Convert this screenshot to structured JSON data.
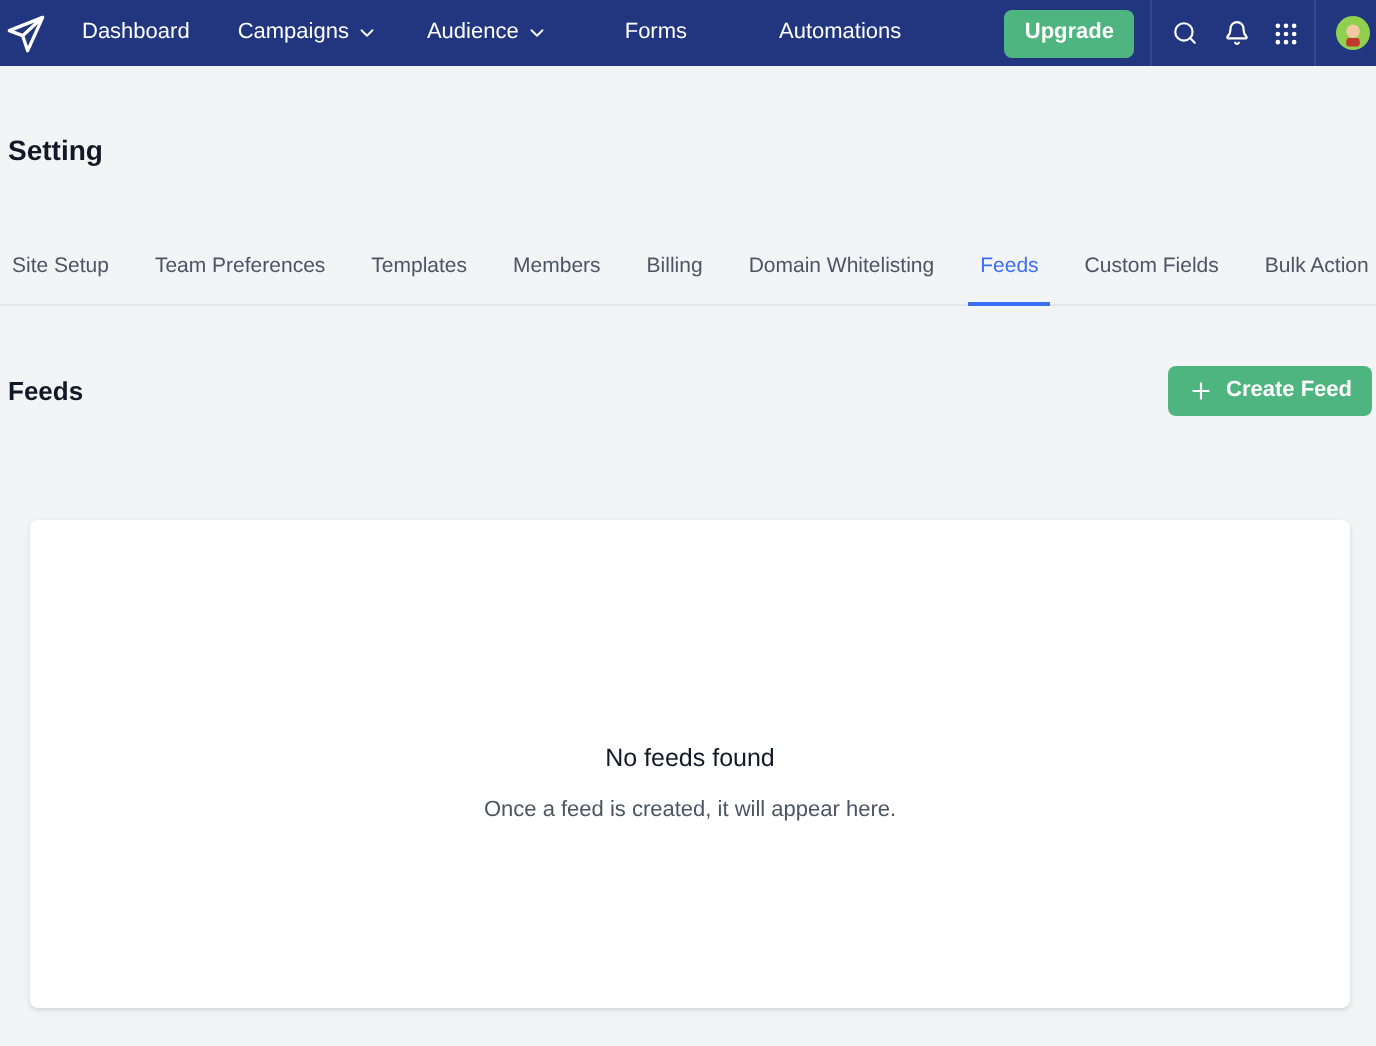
{
  "nav": {
    "items": [
      {
        "label": "Dashboard",
        "dropdown": false
      },
      {
        "label": "Campaigns",
        "dropdown": true
      },
      {
        "label": "Audience",
        "dropdown": true
      },
      {
        "label": "Forms",
        "dropdown": false
      },
      {
        "label": "Automations",
        "dropdown": false
      }
    ],
    "upgrade": "Upgrade"
  },
  "page_title": "Setting",
  "tabs": [
    {
      "label": "Site Setup",
      "selected": false
    },
    {
      "label": "Team Preferences",
      "selected": false
    },
    {
      "label": "Templates",
      "selected": false
    },
    {
      "label": "Members",
      "selected": false
    },
    {
      "label": "Billing",
      "selected": false
    },
    {
      "label": "Domain Whitelisting",
      "selected": false
    },
    {
      "label": "Feeds",
      "selected": true
    },
    {
      "label": "Custom Fields",
      "selected": false
    },
    {
      "label": "Bulk Action",
      "selected": false
    }
  ],
  "section": {
    "title": "Feeds",
    "button": "Create Feed"
  },
  "empty_state": {
    "title": "No feeds found",
    "message": "Once a feed is created, it will appear here."
  }
}
